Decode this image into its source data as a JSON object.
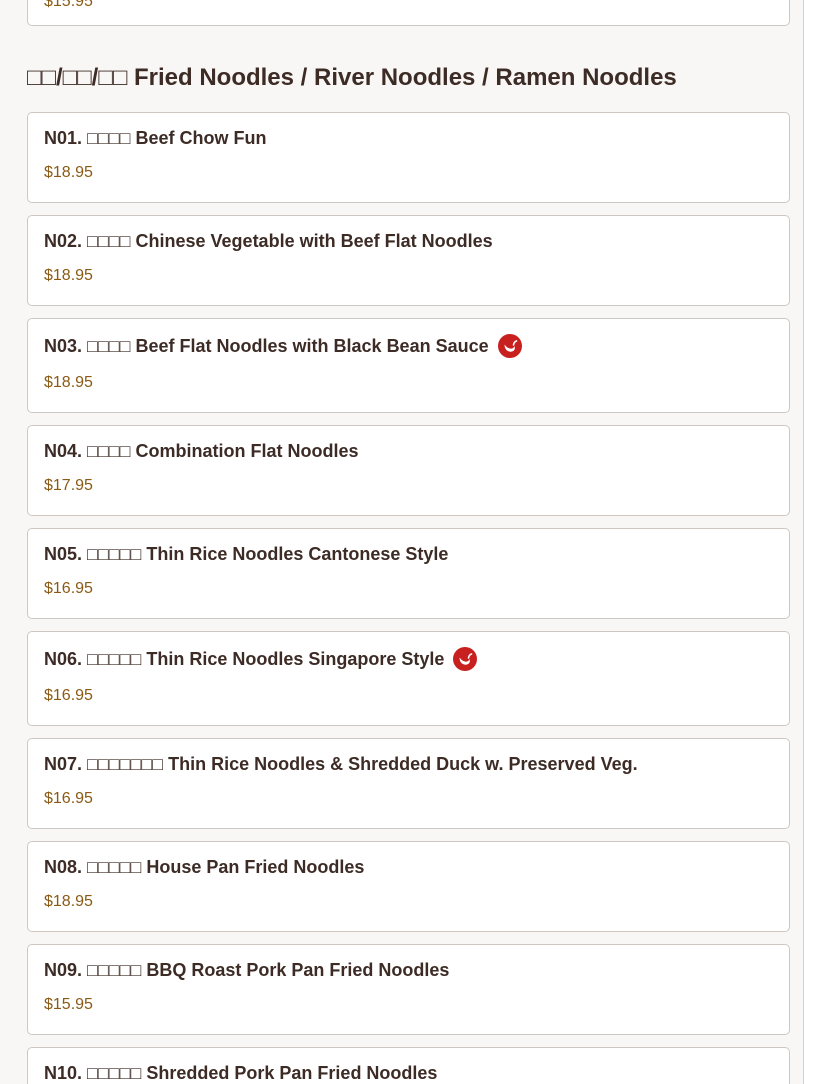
{
  "previous_item": {
    "price": "$15.95"
  },
  "section": {
    "title": "□□/□□/□□ Fried Noodles / River Noodles / Ramen Noodles"
  },
  "items": [
    {
      "name": "N01. □□□□ Beef Chow Fun",
      "price": "$18.95",
      "spicy": false
    },
    {
      "name": "N02. □□□□ Chinese Vegetable with Beef Flat Noodles",
      "price": "$18.95",
      "spicy": false
    },
    {
      "name": "N03. □□□□ Beef Flat Noodles with Black Bean Sauce",
      "price": "$18.95",
      "spicy": true
    },
    {
      "name": "N04. □□□□ Combination Flat Noodles",
      "price": "$17.95",
      "spicy": false
    },
    {
      "name": "N05. □□□□□ Thin Rice Noodles Cantonese Style",
      "price": "$16.95",
      "spicy": false
    },
    {
      "name": "N06. □□□□□ Thin Rice Noodles Singapore Style",
      "price": "$16.95",
      "spicy": true
    },
    {
      "name": "N07. □□□□□□□ Thin Rice Noodles & Shredded Duck w. Preserved Veg.",
      "price": "$16.95",
      "spicy": false
    },
    {
      "name": "N08. □□□□□ House Pan Fried Noodles",
      "price": "$18.95",
      "spicy": false
    },
    {
      "name": "N09. □□□□□ BBQ Roast Pork Pan Fried Noodles",
      "price": "$15.95",
      "spicy": false
    },
    {
      "name": "N10. □□□□□ Shredded Pork Pan Fried Noodles",
      "price": "",
      "spicy": false
    }
  ],
  "icons": {
    "spicy": "spicy-pepper-icon"
  },
  "colors": {
    "price": "#8a5a14",
    "spicy_badge": "#c8201e",
    "card_border": "#cfc8c2",
    "background": "#f9f7f5"
  }
}
